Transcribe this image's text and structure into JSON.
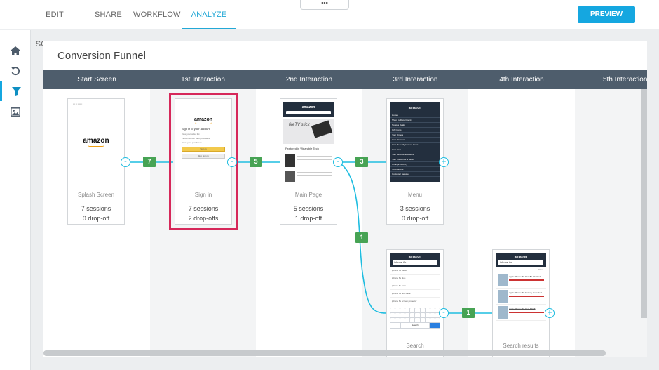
{
  "nav": {
    "tabs": [
      {
        "label": "EDIT SCREENS"
      },
      {
        "label": "SHARE"
      },
      {
        "label": "WORKFLOW"
      },
      {
        "label": "ANALYZE"
      }
    ],
    "active_tab": "ANALYZE",
    "handle": "▪▪▪",
    "preview_label": "PREVIEW"
  },
  "sidebar": {
    "items": [
      {
        "icon": "home-icon"
      },
      {
        "icon": "undo-icon"
      },
      {
        "icon": "filter-icon"
      },
      {
        "icon": "image-icon"
      }
    ]
  },
  "funnel": {
    "title": "Conversion Funnel",
    "columns": [
      "Start Screen",
      "1st Interaction",
      "2nd Interaction",
      "3rd Interaction",
      "4th Interaction",
      "5th Interaction"
    ],
    "cards": [
      {
        "name": "Splash Screen",
        "sessions": "7 sessions",
        "dropoffs": "0 drop-off"
      },
      {
        "name": "Sign in",
        "sessions": "7 sessions",
        "dropoffs": "2 drop-offs"
      },
      {
        "name": "Main Page",
        "sessions": "5 sessions",
        "dropoffs": "1 drop-off"
      },
      {
        "name": "Menu",
        "sessions": "3 sessions",
        "dropoffs": "0 drop-off"
      },
      {
        "name": "Search",
        "sessions": "",
        "dropoffs": ""
      },
      {
        "name": "Search results",
        "sessions": "",
        "dropoffs": ""
      }
    ],
    "transitions": [
      "7",
      "5",
      "3",
      "1",
      "1"
    ],
    "minus": "-",
    "plus": "+"
  },
  "thumbs": {
    "brand": "amazon",
    "signin_heading": "Sign in to your account",
    "signin_items": [
      "View your order list",
      "Find & reorder past purchases",
      "Track your purchases"
    ],
    "signin_button": "Sign in",
    "skip_button": "Skip sign in",
    "banner": "fireTV stick",
    "featured": "Featured in Wearable Tech",
    "menu_items": [
      "Home",
      "Shop by Department",
      "Today's Deals",
      "Gift Cards",
      "Your Orders",
      "Your Account",
      "Your Recently Viewed Items",
      "Your Lists",
      "Your Recommendations",
      "Your Subscribe & Save",
      "Change Country",
      "Notifications",
      "Customer Service"
    ],
    "search_query": "iphone 6s",
    "suggestions": [
      "iphone 6s cases",
      "iphone 6s plus",
      "iphone 6s case",
      "iphone 6s plus case",
      "iphone 6s screen protector"
    ],
    "search_key": "Search",
    "results_query": "iphone 6s",
    "results_filter": "Filter",
    "result_items": [
      "Apple iPhone 6S 64 GB Unlocked",
      "Apple iPhone 6S Factory Unlocked",
      "Apple iPhone 6S Plus 64GB"
    ]
  },
  "colors": {
    "accent": "#15a7e0",
    "header": "#4e5d6c",
    "badge": "#47a354",
    "selected": "#d6285a",
    "connector": "#1fbde0"
  }
}
